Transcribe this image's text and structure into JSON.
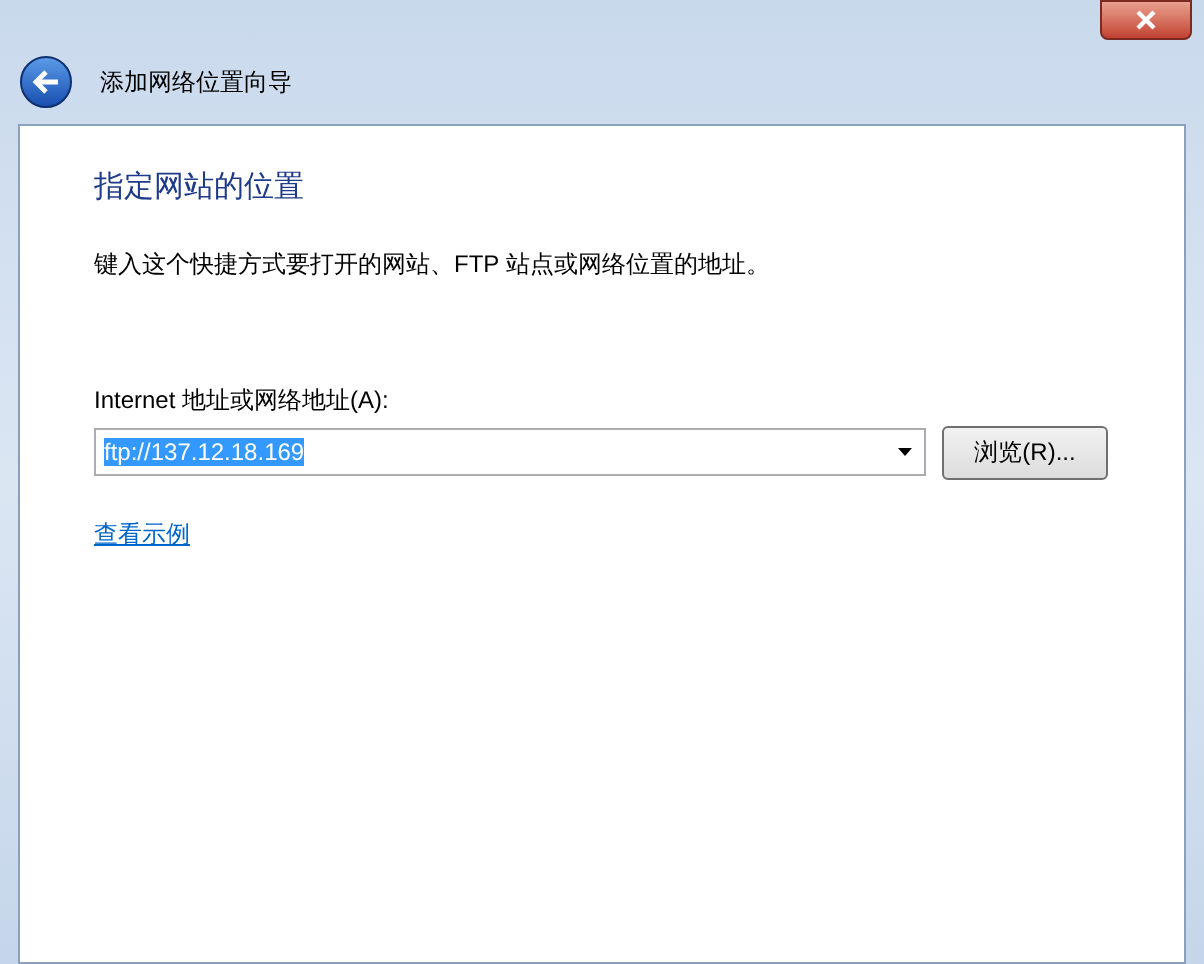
{
  "window": {
    "title": "添加网络位置向导"
  },
  "heading": "指定网站的位置",
  "description": "键入这个快捷方式要打开的网站、FTP 站点或网络位置的地址。",
  "address_field": {
    "label": "Internet 地址或网络地址(A):",
    "value": "ftp://137.12.18.169",
    "text_selected": true
  },
  "browse_button": "浏览(R)...",
  "examples_link": "查看示例"
}
